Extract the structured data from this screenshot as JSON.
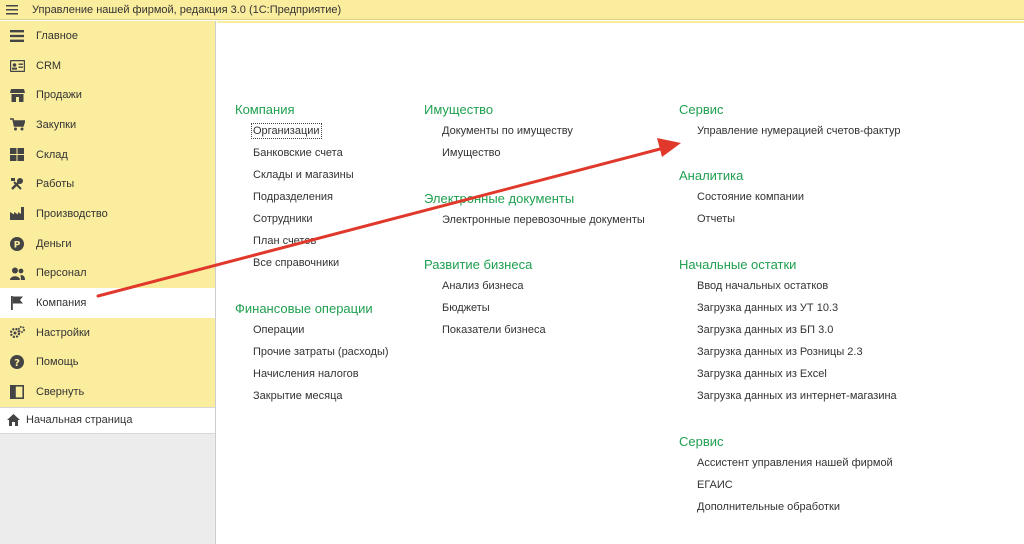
{
  "titlebar": {
    "menu_icon": "hamburger-icon",
    "title": "Управление нашей фирмой, редакция 3.0  (1С:Предприятие)"
  },
  "sidebar": {
    "items": [
      {
        "label": "Главное",
        "icon": "list-icon"
      },
      {
        "label": "CRM",
        "icon": "id-card-icon"
      },
      {
        "label": "Продажи",
        "icon": "shop-icon"
      },
      {
        "label": "Закупки",
        "icon": "cart-icon"
      },
      {
        "label": "Склад",
        "icon": "warehouse-icon"
      },
      {
        "label": "Работы",
        "icon": "tools-icon"
      },
      {
        "label": "Производство",
        "icon": "factory-icon"
      },
      {
        "label": "Деньги",
        "icon": "ruble-coin-icon"
      },
      {
        "label": "Персонал",
        "icon": "people-icon"
      },
      {
        "label": "Компания",
        "icon": "flag-icon",
        "active": true
      },
      {
        "label": "Настройки",
        "icon": "gear-icon"
      },
      {
        "label": "Помощь",
        "icon": "question-icon"
      },
      {
        "label": "Свернуть",
        "icon": "collapse-panel-icon"
      }
    ],
    "home": {
      "label": "Начальная страница",
      "icon": "home-icon"
    }
  },
  "main": {
    "col1": {
      "company": {
        "title": "Компания",
        "links": [
          "Организации",
          "Банковские счета",
          "Склады и магазины",
          "Подразделения",
          "Сотрудники",
          "План счетов",
          "Все справочники"
        ]
      },
      "finance": {
        "title": "Финансовые операции",
        "links": [
          "Операции",
          "Прочие затраты (расходы)",
          "Начисления налогов",
          "Закрытие месяца"
        ]
      }
    },
    "col2": {
      "property": {
        "title": "Имущество",
        "links": [
          "Документы по имуществу",
          "Имущество"
        ]
      },
      "edocs": {
        "title": "Электронные документы",
        "links": [
          "Электронные перевозочные документы"
        ]
      },
      "business": {
        "title": "Развитие бизнеса",
        "links": [
          "Анализ бизнеса",
          "Бюджеты",
          "Показатели бизнеса"
        ]
      }
    },
    "col3": {
      "service1": {
        "title": "Сервис",
        "links": [
          "Управление нумерацией счетов-фактур"
        ]
      },
      "analytics": {
        "title": "Аналитика",
        "links": [
          "Состояние компании",
          "Отчеты"
        ]
      },
      "balances": {
        "title": "Начальные остатки",
        "links": [
          "Ввод начальных остатков",
          "Загрузка данных из УТ 10.3",
          "Загрузка данных из БП 3.0",
          "Загрузка данных из Розницы 2.3",
          "Загрузка данных из Excel",
          "Загрузка данных из интернет-магазина"
        ]
      },
      "service2": {
        "title": "Сервис",
        "links": [
          "Ассистент управления нашей фирмой",
          "ЕГАИС",
          "Дополнительные обработки"
        ]
      }
    }
  },
  "colors": {
    "panel": "#fbed9e",
    "group_title": "#20a050",
    "annotation_arrow": "#e0392b"
  }
}
